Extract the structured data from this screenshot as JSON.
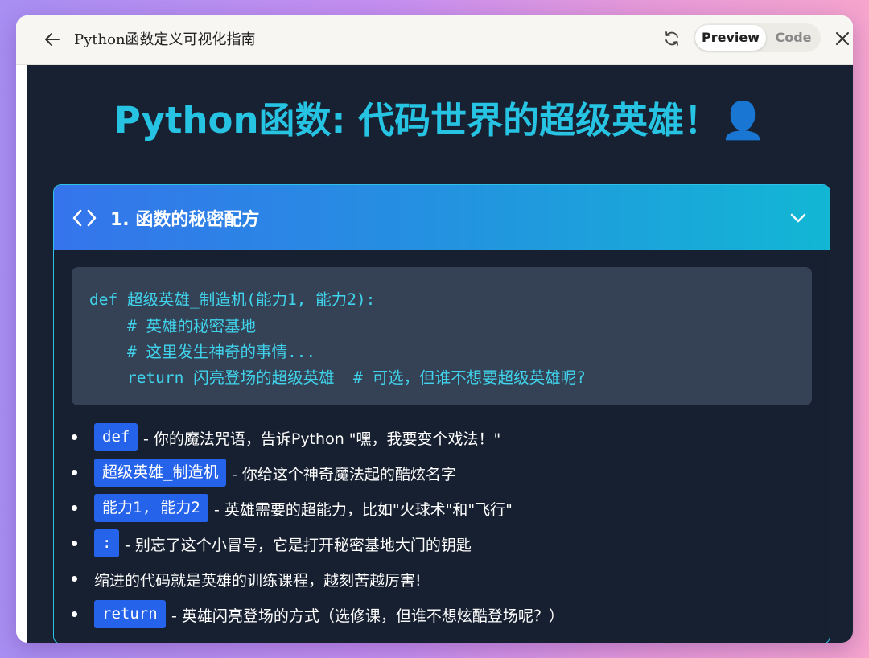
{
  "window": {
    "title": "Python函数定义可视化指南",
    "toggle": {
      "preview": "Preview",
      "code": "Code",
      "active": "Preview"
    }
  },
  "icons": {
    "back": "arrow-left-icon",
    "refresh": "refresh-icon",
    "close": "close-icon",
    "section": "code-brackets-icon",
    "expand": "chevron-down-icon"
  },
  "page": {
    "heading": "Python函数: 代码世界的超级英雄！👤"
  },
  "section": {
    "title": "1. 函数的秘密配方",
    "code_lines": [
      "def 超级英雄_制造机(能力1, 能力2):",
      "    # 英雄的秘密基地",
      "    # 这里发生神奇的事情...",
      "    return 闪亮登场的超级英雄  # 可选，但谁不想要超级英雄呢?"
    ],
    "bullets": [
      {
        "tag": "def",
        "text": "- 你的魔法咒语，告诉Python \"嘿，我要变个戏法！\""
      },
      {
        "tag": "超级英雄_制造机",
        "text": "- 你给这个神奇魔法起的酷炫名字"
      },
      {
        "tag": "能力1, 能力2",
        "text": "- 英雄需要的超能力，比如\"火球术\"和\"飞行\""
      },
      {
        "tag": ":",
        "text": "- 别忘了这个小冒号，它是打开秘密基地大门的钥匙"
      },
      {
        "tag": "",
        "text": "缩进的代码就是英雄的训练课程，越刻苦越厉害!"
      },
      {
        "tag": "return",
        "text": "- 英雄闪亮登场的方式（选修课，但谁不想炫酷登场呢？）"
      }
    ]
  },
  "colors": {
    "heading": "#26c3e3",
    "code_text": "#40d4ec",
    "tag_bg": "#2563eb",
    "content_bg": "#182131",
    "card_border": "#2fc0e6"
  }
}
